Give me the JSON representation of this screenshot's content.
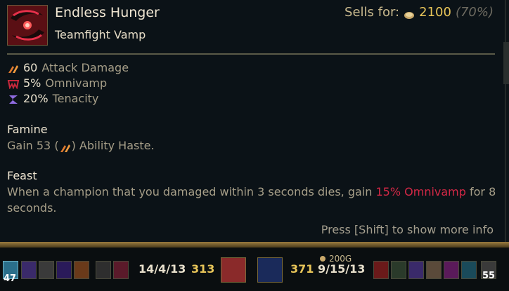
{
  "item": {
    "name": "Endless Hunger",
    "subtitle": "Teamfight Vamp",
    "sell_label": "Sells for:",
    "sell_value": "2100",
    "sell_percent": "(70%)",
    "icon": "endless-hunger-icon"
  },
  "stats": [
    {
      "value": "60",
      "label": "Attack Damage",
      "icon": "attack-damage-icon",
      "color": "#e07a2e"
    },
    {
      "value": "5%",
      "label": "Omnivamp",
      "icon": "omnivamp-icon",
      "color": "#c8283c"
    },
    {
      "value": "20%",
      "label": "Tenacity",
      "icon": "tenacity-icon",
      "color": "#8f6be0"
    }
  ],
  "passives": {
    "famine_title": "Famine",
    "famine_text_a": "Gain 53 (",
    "famine_text_b": ") Ability Haste.",
    "feast_title": "Feast",
    "feast_text_a": "When a champion that you damaged within 3 seconds dies, gain ",
    "feast_highlight": "15% Omnivamp",
    "feast_text_b": " for 8",
    "feast_text_c": "seconds."
  },
  "hint": "Press [Shift] to show more info",
  "scoreboard": {
    "left": {
      "level": "47",
      "kda": "14/4/13",
      "cs": "313"
    },
    "right": {
      "level": "55",
      "kda": "9/15/13",
      "cs": "371"
    },
    "gold_diff": "200G"
  },
  "colors": {
    "gold": "#e8c559",
    "highlight_red": "#d32846",
    "border_gold": "#9a7b3f"
  }
}
